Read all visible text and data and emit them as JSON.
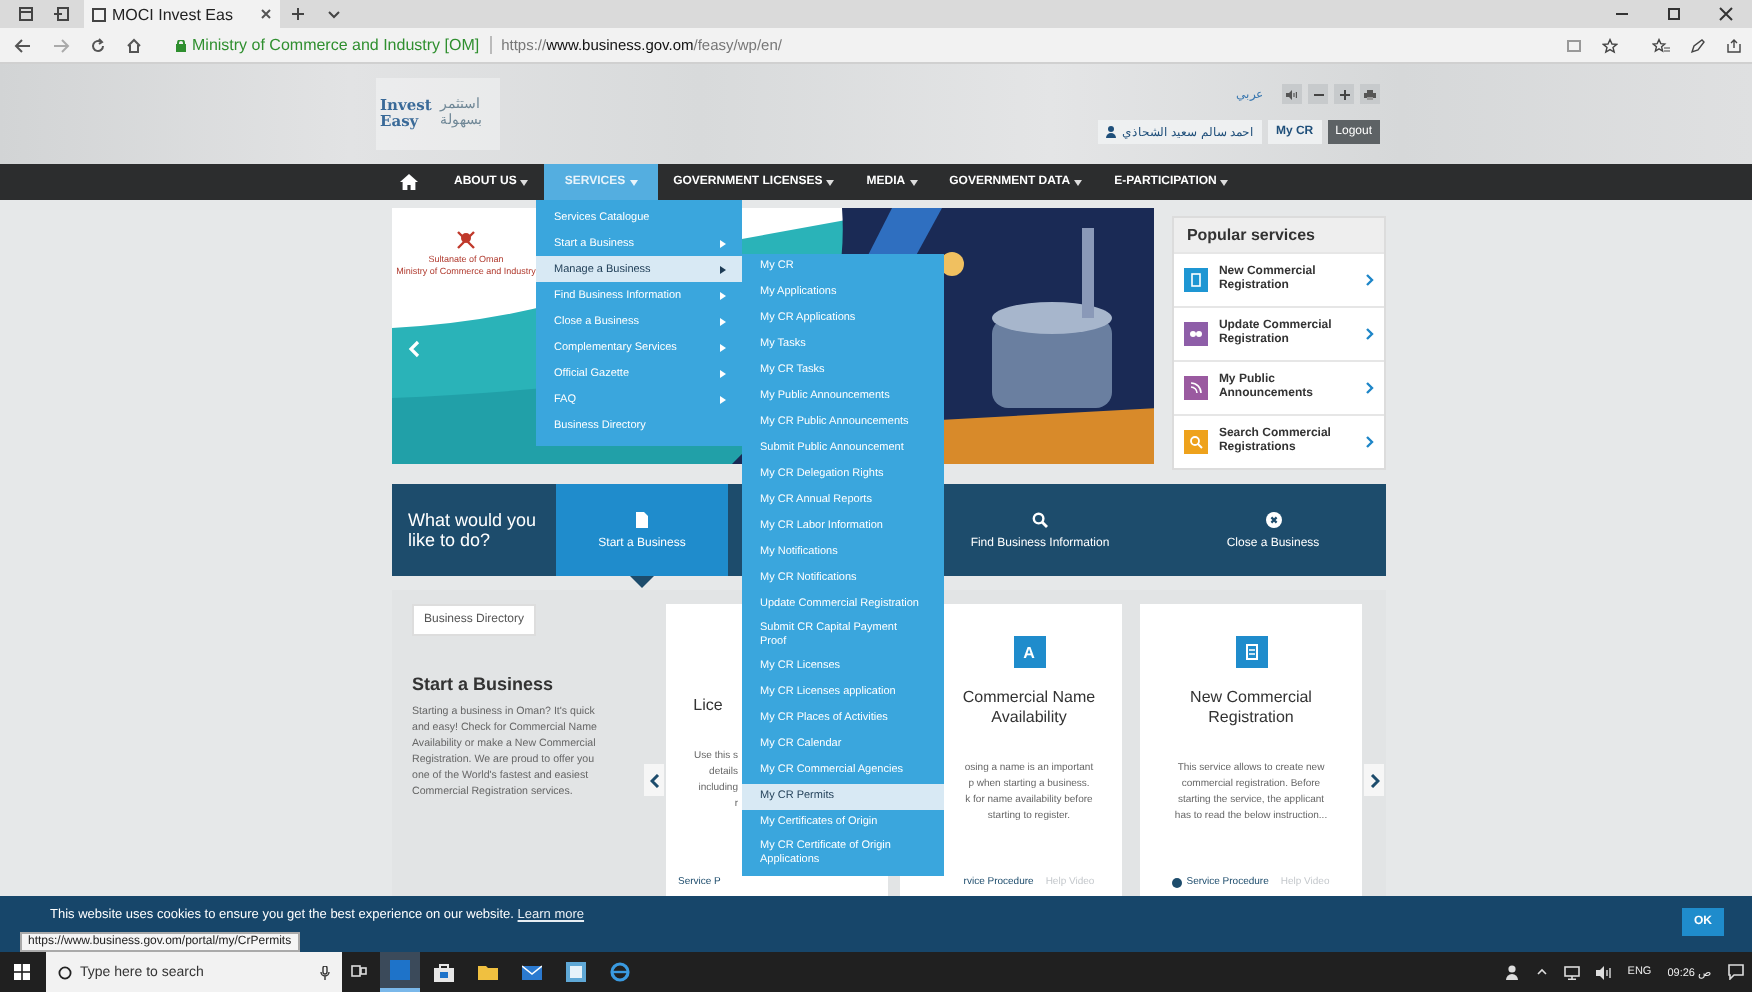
{
  "browser": {
    "tab_title": "MOCI Invest Eas",
    "site_identity": "Ministry of Commerce and Industry [OM]",
    "url": "https://**www.business.gov.om**/feasy/wp/en/"
  },
  "header": {
    "logo_en": "Invest Easy",
    "logo_ar": "استثمر بسهولة",
    "language": "عربي",
    "user_name": "احمد سالم سعيد الشحاذي",
    "my_cr": "My CR",
    "logout": "Logout"
  },
  "nav": [
    {
      "label": "ABOUT US",
      "selected": false
    },
    {
      "label": "SERVICES",
      "selected": true
    },
    {
      "label": "GOVERNMENT LICENSES",
      "selected": false
    },
    {
      "label": "MEDIA",
      "selected": false
    },
    {
      "label": "GOVERNMENT DATA",
      "selected": false
    },
    {
      "label": "E-PARTICIPATION",
      "selected": false
    }
  ],
  "services_menu": [
    {
      "label": "Services Catalogue",
      "submenu": false,
      "selected": false
    },
    {
      "label": "Start a Business",
      "submenu": true,
      "selected": false
    },
    {
      "label": "Manage a Business",
      "submenu": true,
      "selected": true
    },
    {
      "label": "Find Business Information",
      "submenu": true,
      "selected": false
    },
    {
      "label": "Close a Business",
      "submenu": true,
      "selected": false
    },
    {
      "label": "Complementary Services",
      "submenu": true,
      "selected": false
    },
    {
      "label": "Official Gazette",
      "submenu": true,
      "selected": false
    },
    {
      "label": "FAQ",
      "submenu": true,
      "selected": false
    },
    {
      "label": "Business Directory",
      "submenu": false,
      "selected": false
    }
  ],
  "manage_submenu": [
    {
      "label": "My CR",
      "selected": false
    },
    {
      "label": "My Applications",
      "selected": false
    },
    {
      "label": "My CR Applications",
      "selected": false
    },
    {
      "label": "My Tasks",
      "selected": false
    },
    {
      "label": "My CR Tasks",
      "selected": false
    },
    {
      "label": "My Public Announcements",
      "selected": false
    },
    {
      "label": "My CR Public Announcements",
      "selected": false
    },
    {
      "label": "Submit Public Announcement",
      "selected": false
    },
    {
      "label": "My CR Delegation Rights",
      "selected": false
    },
    {
      "label": "My CR Annual Reports",
      "selected": false
    },
    {
      "label": "My CR Labor Information",
      "selected": false
    },
    {
      "label": "My Notifications",
      "selected": false
    },
    {
      "label": "My CR Notifications",
      "selected": false
    },
    {
      "label": "Update Commercial Registration",
      "selected": false
    },
    {
      "label": "Submit CR Capital Payment Proof",
      "selected": false
    },
    {
      "label": "My CR Licenses",
      "selected": false
    },
    {
      "label": "My CR Licenses application",
      "selected": false
    },
    {
      "label": "My CR Places of Activities",
      "selected": false
    },
    {
      "label": "My CR Calendar",
      "selected": false
    },
    {
      "label": "My CR Commercial Agencies",
      "selected": false
    },
    {
      "label": "My CR Permits",
      "selected": true
    },
    {
      "label": "My Certificates of Origin",
      "selected": false
    },
    {
      "label": "My CR Certificate of Origin Applications",
      "selected": false
    }
  ],
  "hero": {
    "emblem_line1": "Sultanate of Oman",
    "emblem_line2": "Ministry of Commerce and Industry"
  },
  "popular_services": {
    "title": "Popular services",
    "items": [
      {
        "label": "New Commercial Registration",
        "color": "#1e96d3"
      },
      {
        "label": "Update Commercial Registration",
        "color": "#8e5ea8"
      },
      {
        "label": "My Public Announcements",
        "color": "#9a5aa0"
      },
      {
        "label": "Search Commercial Registrations",
        "color": "#eea21c"
      }
    ]
  },
  "what_bar": {
    "prompt": "What would you like to do?",
    "items": [
      {
        "label": "Start a Business",
        "kind": "start",
        "selected": true
      },
      {
        "label": "Find Business Information",
        "kind": "find",
        "selected": false
      },
      {
        "label": "Close a Business",
        "kind": "close",
        "selected": false
      }
    ]
  },
  "panel": {
    "directory_button": "Business Directory",
    "heading": "Start a Business",
    "text": "Starting a business in Oman? It's quick and easy! Check for Commercial Name Availability or make a New Commercial Registration. We are proud to offer you one of the World's fastest and easiest Commercial Registration services."
  },
  "cards": [
    {
      "kind": "cut_right",
      "title": "Lice",
      "lines": [
        "Use this s",
        "details",
        "including",
        "r"
      ],
      "footer": "Service P"
    },
    {
      "kind": "cut_left",
      "icon": "A",
      "title": "Commercial Name Availability",
      "lines": [
        "osing a name is an important",
        "p when starting a business.",
        "k for name availability before",
        "starting to register."
      ],
      "footer": "rvice Procedure",
      "video": "Help Video"
    },
    {
      "kind": "full",
      "title": "New Commercial Registration",
      "lines": [
        "This service allows to create new",
        "commercial registration. Before",
        "starting the service, the applicant",
        "has to read the below instruction..."
      ],
      "footer": "Service Procedure",
      "video": "Help Video"
    }
  ],
  "cookie": {
    "text": "This website uses cookies to ensure you get the best experience on our website.",
    "link": "Learn more",
    "button": "OK"
  },
  "status_url": "https://www.business.gov.om/portal/my/CrPermits",
  "taskbar": {
    "search_placeholder": "Type here to search",
    "language": "ENG",
    "time": "09:26 ص"
  }
}
